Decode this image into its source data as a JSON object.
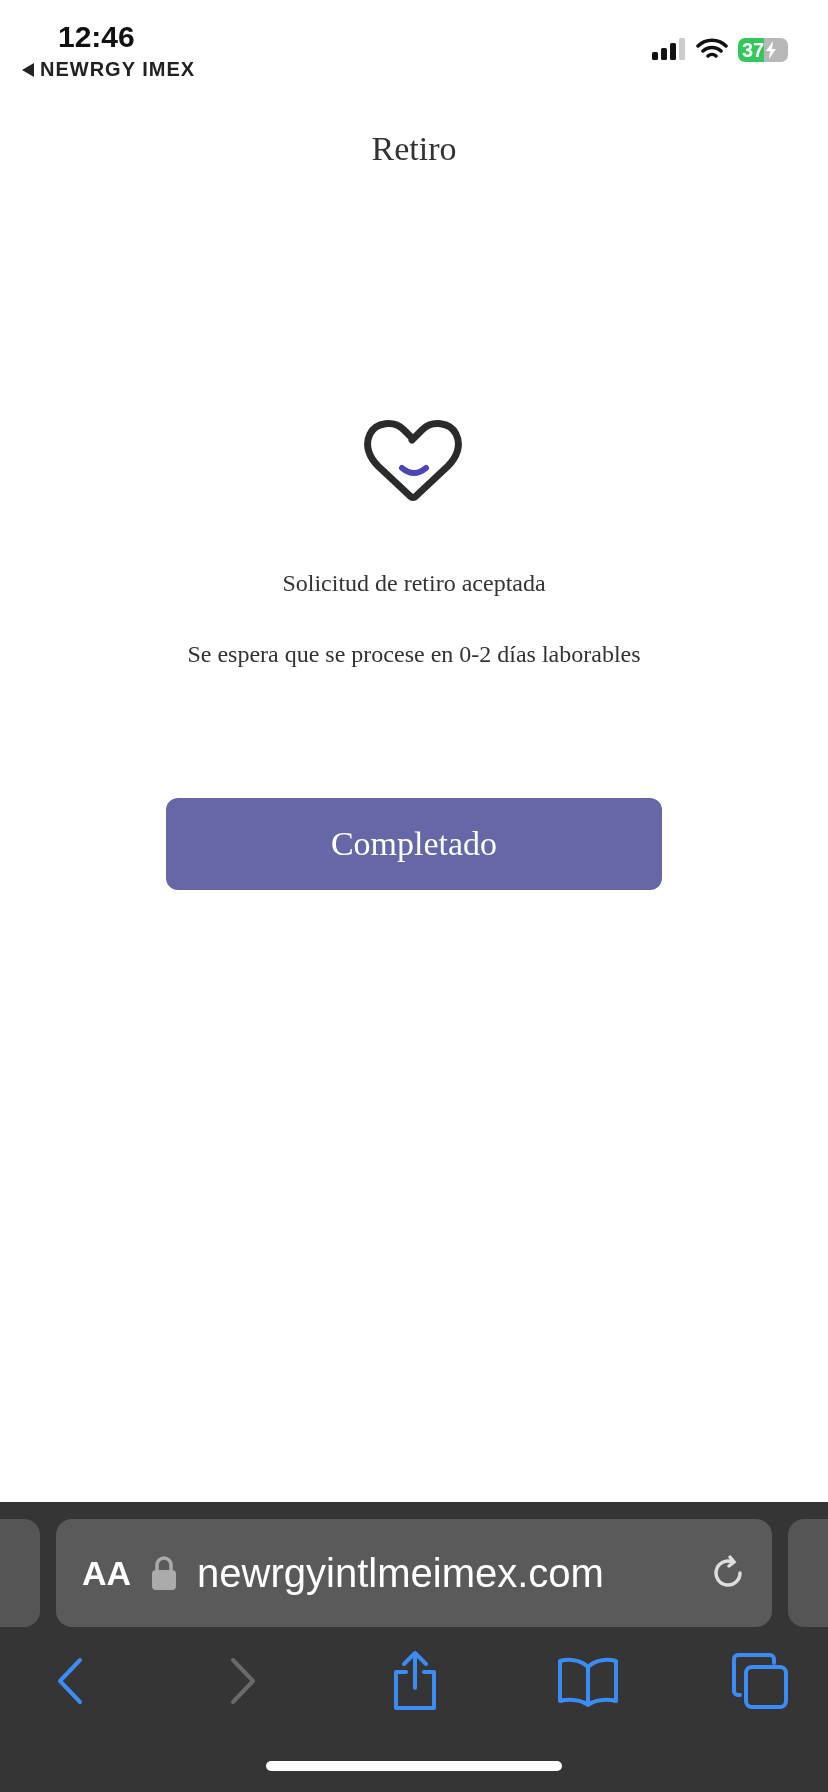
{
  "status_bar": {
    "time": "12:46",
    "back_app": "NEWRGY IMEX",
    "battery": "37",
    "charging": true
  },
  "header": {
    "title": "Retiro"
  },
  "result": {
    "message": "Solicitud de retiro aceptada",
    "detail": "Se espera que se procese en 0-2 días laborables"
  },
  "button": {
    "label": "Completado"
  },
  "browser": {
    "text_size": "AA",
    "url": "newrgyintlmeimex.com",
    "toolbar": [
      {
        "kind": "back",
        "disabled": false
      },
      {
        "kind": "forward",
        "disabled": true
      },
      {
        "kind": "share",
        "disabled": false
      },
      {
        "kind": "bookmarks",
        "disabled": false
      },
      {
        "kind": "tabs",
        "disabled": false
      }
    ]
  }
}
